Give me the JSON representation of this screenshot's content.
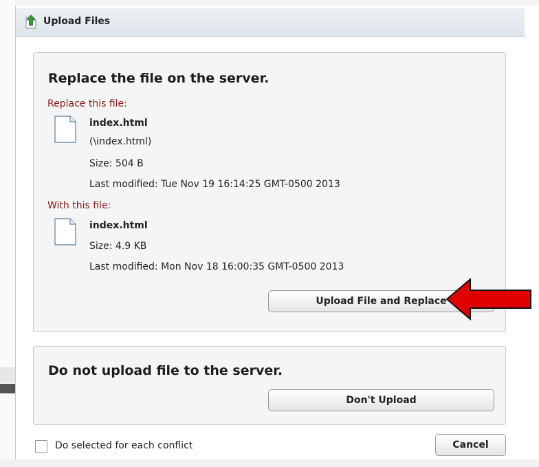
{
  "dialog": {
    "title": "Upload Files",
    "icon": "green-upload-arrow-icon"
  },
  "replace_section": {
    "heading": "Replace the file on the server.",
    "replace_label": "Replace this file:",
    "server_file": {
      "name": "index.html",
      "path": "(\\index.html)",
      "size": "Size: 504  B",
      "modified": "Last modified: Tue Nov 19 16:14:25 GMT-0500 2013"
    },
    "with_label": "With this file:",
    "local_file": {
      "name": "index.html",
      "size": "Size: 4.9 KB",
      "modified": "Last modified: Mon Nov 18 16:00:35 GMT-0500 2013"
    },
    "button_label": "Upload File and Replace"
  },
  "skip_section": {
    "heading": "Do not upload file to the server.",
    "button_label": "Don't Upload"
  },
  "footer": {
    "checkbox_label": "Do selected for each conflict",
    "checkbox_checked": false,
    "cancel_label": "Cancel"
  },
  "colors": {
    "label_red": "#8b1a1a",
    "arrow_red": "#e00000",
    "upload_icon_green": "#2e9e2e"
  }
}
